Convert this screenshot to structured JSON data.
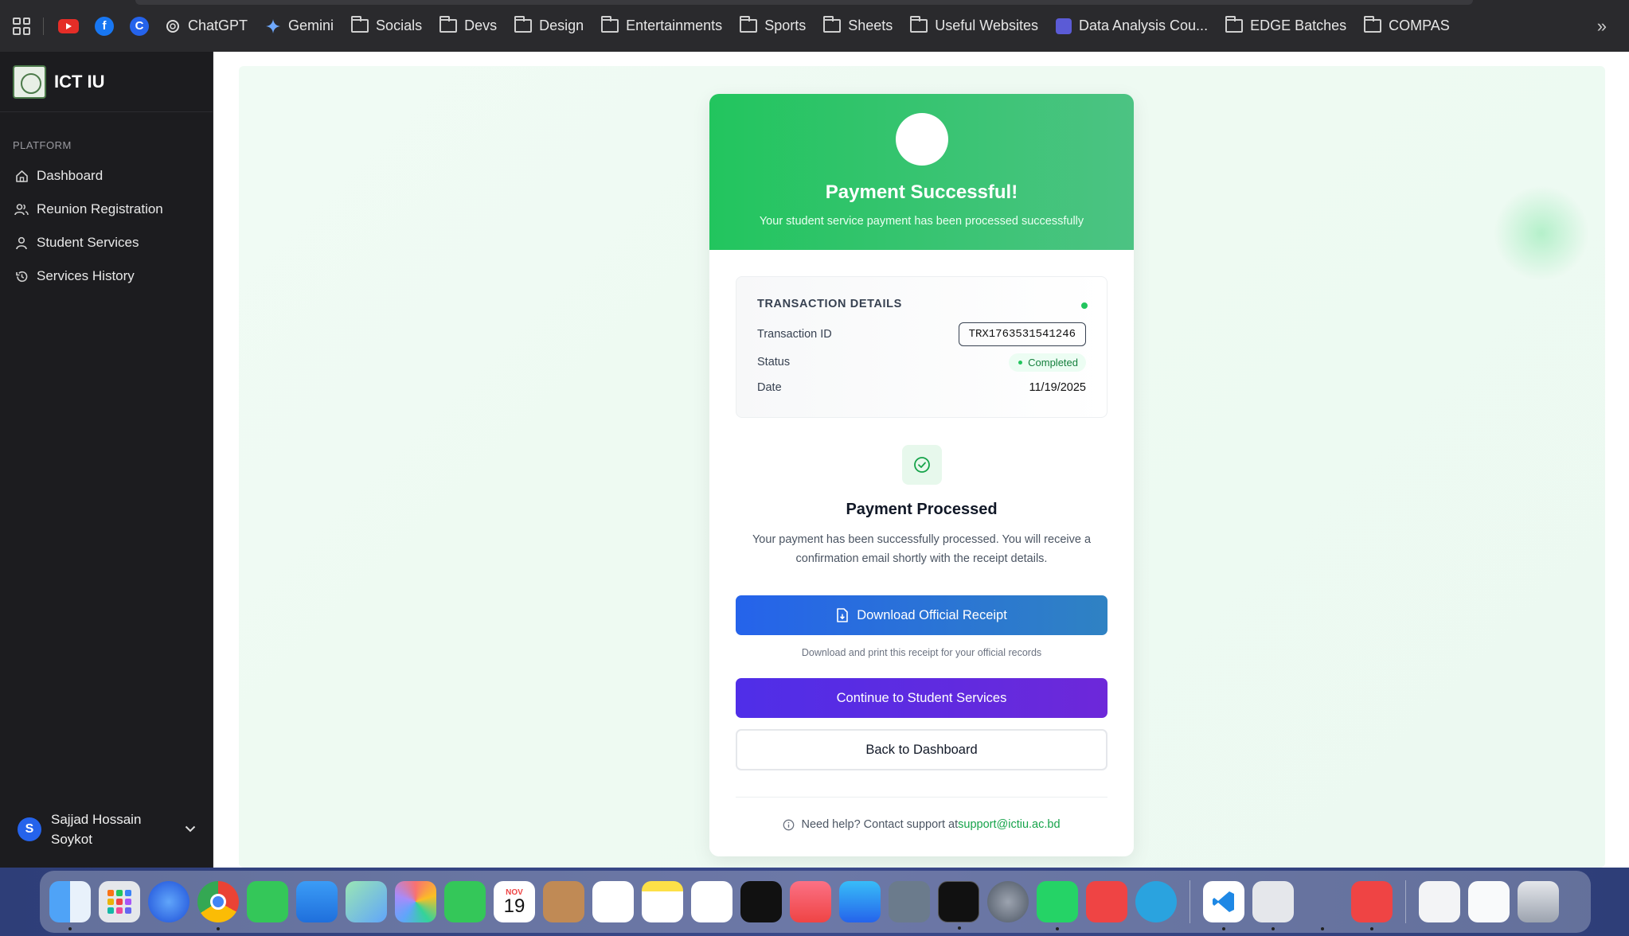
{
  "bookmarks": {
    "items": [
      {
        "label": "ChatGPT",
        "icon": "chatgpt-icon",
        "kind": "site"
      },
      {
        "label": "Gemini",
        "icon": "gemini-icon",
        "kind": "site"
      },
      {
        "label": "Socials",
        "icon": "folder-icon",
        "kind": "folder"
      },
      {
        "label": "Devs",
        "icon": "folder-icon",
        "kind": "folder"
      },
      {
        "label": "Design",
        "icon": "folder-icon",
        "kind": "folder"
      },
      {
        "label": "Entertainments",
        "icon": "folder-icon",
        "kind": "folder"
      },
      {
        "label": "Sports",
        "icon": "folder-icon",
        "kind": "folder"
      },
      {
        "label": "Sheets",
        "icon": "folder-icon",
        "kind": "folder"
      },
      {
        "label": "Useful Websites",
        "icon": "folder-icon",
        "kind": "folder"
      },
      {
        "label": "Data Analysis Cou...",
        "icon": "course-icon",
        "kind": "site"
      },
      {
        "label": "EDGE Batches",
        "icon": "folder-icon",
        "kind": "folder"
      },
      {
        "label": "COMPAS",
        "icon": "folder-icon",
        "kind": "folder"
      }
    ],
    "more": "»"
  },
  "sidebar": {
    "brand": "ICT IU",
    "section_title": "PLATFORM",
    "items": [
      {
        "label": "Dashboard",
        "icon": "home-icon"
      },
      {
        "label": "Reunion Registration",
        "icon": "users-icon"
      },
      {
        "label": "Student Services",
        "icon": "user-icon"
      },
      {
        "label": "Services History",
        "icon": "history-icon"
      }
    ],
    "user": {
      "initial": "S",
      "name": "Sajjad Hossain Soykot"
    }
  },
  "card": {
    "title": "Payment Successful!",
    "subtitle": "Your student service payment has been processed successfully",
    "transaction": {
      "heading": "TRANSACTION DETAILS",
      "id_label": "Transaction ID",
      "id_value": "TRX1763531541246",
      "status_label": "Status",
      "status_value": "Completed",
      "date_label": "Date",
      "date_value": "11/19/2025"
    },
    "processed_title": "Payment Processed",
    "processed_text": "Your payment has been successfully processed. You will receive a confirmation email shortly with the receipt details.",
    "download_label": "Download Official Receipt",
    "download_note": "Download and print this receipt for your official records",
    "continue_label": "Continue to Student Services",
    "back_label": "Back to Dashboard",
    "help_text": "Need help? Contact support at",
    "help_email": "support@ictiu.ac.bd"
  },
  "colors": {
    "success_green": "#22c55e",
    "primary_blue": "#2563eb",
    "primary_purple": "#5b21e6",
    "sidebar_bg": "#1c1c1f"
  },
  "dock": {
    "calendar_month": "NOV",
    "calendar_day": "19"
  }
}
